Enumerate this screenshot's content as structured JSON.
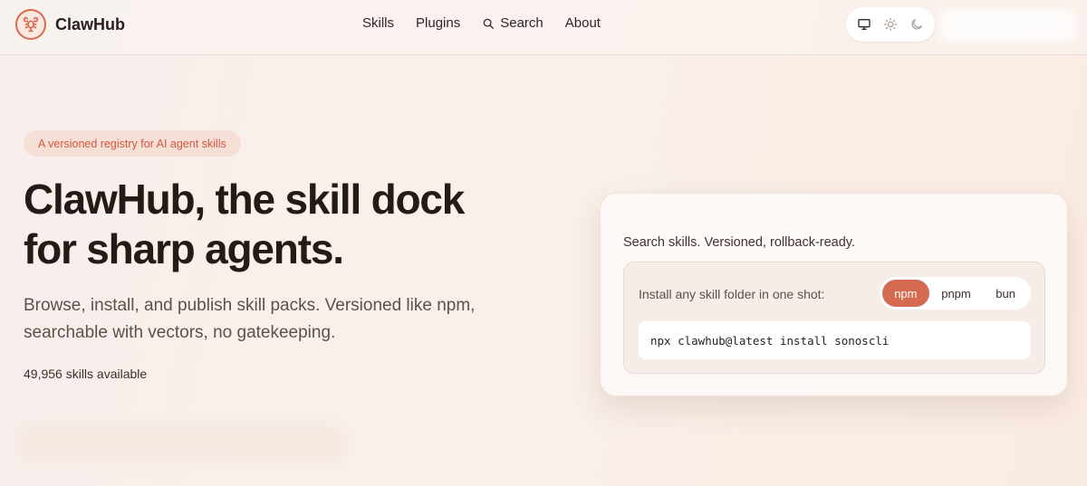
{
  "header": {
    "brand_name": "ClawHub",
    "nav": {
      "skills": "Skills",
      "plugins": "Plugins",
      "search": "Search",
      "about": "About"
    },
    "theme_icons": [
      "monitor-icon",
      "sun-icon",
      "moon-icon"
    ]
  },
  "hero": {
    "badge": "A versioned registry for AI agent skills",
    "title_line1": "ClawHub, the skill dock",
    "title_line2": "for sharp agents.",
    "subtitle_line1": "Browse, install, and publish skill packs. Versioned like npm,",
    "subtitle_line2": "searchable with vectors, no gatekeeping.",
    "skills_count": "49,956 skills available"
  },
  "card": {
    "caption": "Search skills. Versioned, rollback-ready.",
    "install_label": "Install any skill folder in one shot:",
    "package_managers": [
      "npm",
      "pnpm",
      "bun"
    ],
    "selected_package_manager": "npm",
    "command": "npx clawhub@latest install sonoscli"
  },
  "colors": {
    "accent": "#d56a53",
    "badge_bg": "#f6dfd7",
    "badge_text": "#d5583c",
    "text_dark": "#241b17"
  }
}
